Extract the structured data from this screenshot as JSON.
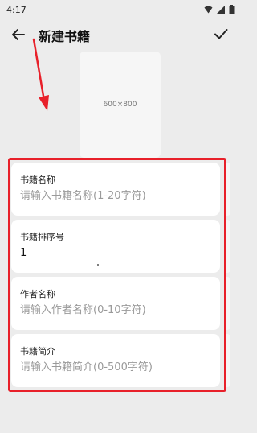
{
  "status_bar": {
    "time": "4:17"
  },
  "app_bar": {
    "title": "新建书籍"
  },
  "cover": {
    "placeholder": "600×800"
  },
  "form": {
    "fields": [
      {
        "label": "书籍名称",
        "value": "",
        "placeholder": "请输入书籍名称(1-20字符)"
      },
      {
        "label": "书籍排序号",
        "value": "1",
        "placeholder": ""
      },
      {
        "label": "作者名称",
        "value": "",
        "placeholder": "请输入作者名称(0-10字符)"
      },
      {
        "label": "书籍简介",
        "value": "",
        "placeholder": "请输入书籍简介(0-500字符)"
      }
    ]
  },
  "colors": {
    "annotation": "#e8202a",
    "background": "#ececec",
    "card": "#ffffff"
  },
  "icons": [
    "wifi-icon",
    "signal-icon",
    "battery-icon",
    "back-arrow-icon",
    "check-icon"
  ]
}
